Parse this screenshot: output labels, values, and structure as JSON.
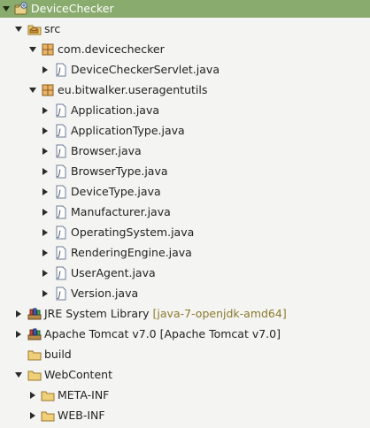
{
  "tree": {
    "project": {
      "label": "DeviceChecker",
      "icon": "project-icon"
    },
    "src": {
      "label": "src",
      "icon": "source-folder-icon"
    },
    "packages": [
      {
        "label": "com.devicechecker",
        "icon": "package-icon",
        "files": [
          {
            "label": "DeviceCheckerServlet.java",
            "icon": "java-file-icon"
          }
        ]
      },
      {
        "label": "eu.bitwalker.useragentutils",
        "icon": "package-icon",
        "files": [
          {
            "label": "Application.java",
            "icon": "java-file-icon"
          },
          {
            "label": "ApplicationType.java",
            "icon": "java-file-icon"
          },
          {
            "label": "Browser.java",
            "icon": "java-file-icon"
          },
          {
            "label": "BrowserType.java",
            "icon": "java-file-icon"
          },
          {
            "label": "DeviceType.java",
            "icon": "java-file-icon"
          },
          {
            "label": "Manufacturer.java",
            "icon": "java-file-icon"
          },
          {
            "label": "OperatingSystem.java",
            "icon": "java-file-icon"
          },
          {
            "label": "RenderingEngine.java",
            "icon": "java-file-icon"
          },
          {
            "label": "UserAgent.java",
            "icon": "java-file-icon"
          },
          {
            "label": "Version.java",
            "icon": "java-file-icon"
          }
        ]
      }
    ],
    "libraries": [
      {
        "label": "JRE System Library",
        "decoration": "[java-7-openjdk-amd64]",
        "icon": "library-icon"
      },
      {
        "label": "Apache Tomcat v7.0",
        "decoration": "[Apache Tomcat v7.0]",
        "icon": "library-icon"
      }
    ],
    "build": {
      "label": "build",
      "icon": "folder-icon"
    },
    "webcontent": {
      "label": "WebContent",
      "icon": "folder-icon",
      "children": [
        {
          "label": "META-INF",
          "icon": "folder-icon"
        },
        {
          "label": "WEB-INF",
          "icon": "folder-icon"
        }
      ]
    }
  },
  "colors": {
    "selection": "#8aab6e",
    "decoration": "#8b7a2c",
    "background": "#f4f4f2"
  }
}
